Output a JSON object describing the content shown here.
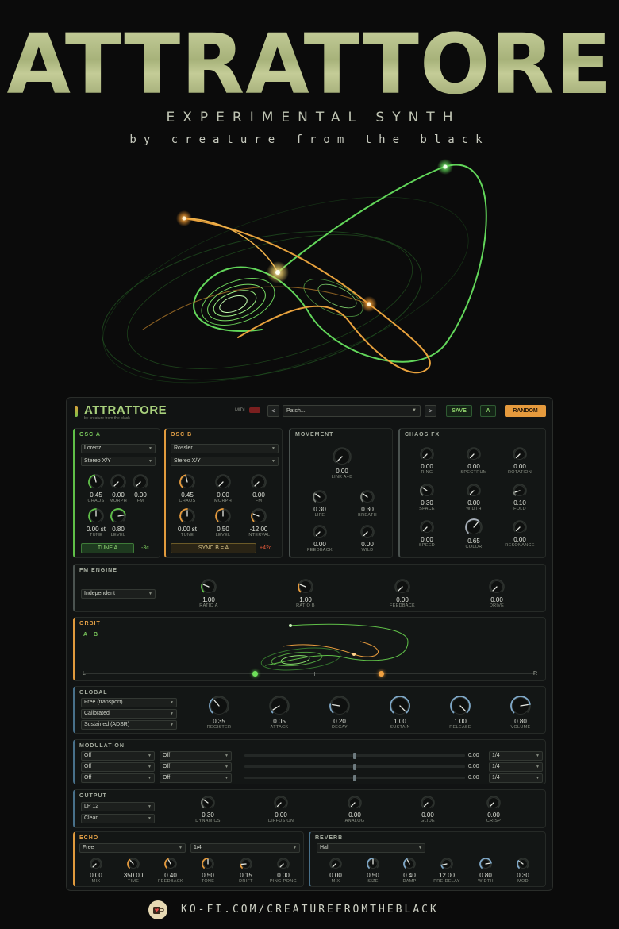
{
  "poster": {
    "title": "ATTRATTORE",
    "subtitle": "EXPERIMENTAL SYNTH",
    "byline": "by creature from the black"
  },
  "colors": {
    "green": "#5fbf48",
    "orange": "#e59a3d",
    "blue": "#48708a",
    "background": "#0b0b0b"
  },
  "header": {
    "logo": "ATTRATTORE",
    "logo_sub": "by creature from the black",
    "midi_label": "MIDI",
    "prev": "<",
    "next": ">",
    "patch": "Patch...",
    "save": "SAVE",
    "ab": "A",
    "random": "RANDOM"
  },
  "osc_a": {
    "title": "OSC A",
    "type": "Lorenz",
    "stereo": "Stereo X/Y",
    "knobs": [
      {
        "value": "0.45",
        "label": "CHAOS"
      },
      {
        "value": "0.00",
        "label": "MORPH"
      },
      {
        "value": "0.00",
        "label": "FM"
      },
      {
        "value": "0.00 st",
        "label": "TUNE"
      },
      {
        "value": "0.80",
        "label": "LEVEL"
      }
    ],
    "button": "TUNE A",
    "cents": "-3c"
  },
  "osc_b": {
    "title": "OSC B",
    "type": "Rossler",
    "stereo": "Stereo X/Y",
    "knobs": [
      {
        "value": "0.45",
        "label": "CHAOS"
      },
      {
        "value": "0.00",
        "label": "MORPH"
      },
      {
        "value": "0.00",
        "label": "FM"
      },
      {
        "value": "0.00 st",
        "label": "TUNE"
      },
      {
        "value": "0.50",
        "label": "LEVEL"
      },
      {
        "value": "-12.00",
        "label": "INTERVAL"
      }
    ],
    "button": "SYNC B = A",
    "cents": "+42c"
  },
  "movement": {
    "title": "MOVEMENT",
    "knobs": [
      {
        "value": "0.00",
        "label": "LINK A+B"
      },
      {
        "value": "0.30",
        "label": "LIFE"
      },
      {
        "value": "0.30",
        "label": "BREATH"
      },
      {
        "value": "0.00",
        "label": "FEEDBACK"
      },
      {
        "value": "0.00",
        "label": "WILD"
      }
    ]
  },
  "chaos_fx": {
    "title": "CHAOS FX",
    "knobs": [
      {
        "value": "0.00",
        "label": "RING"
      },
      {
        "value": "0.00",
        "label": "SPECTRUM"
      },
      {
        "value": "0.00",
        "label": "ROTATION"
      },
      {
        "value": "0.30",
        "label": "SPACE"
      },
      {
        "value": "0.00",
        "label": "WIDTH"
      },
      {
        "value": "0.10",
        "label": "FOLD"
      },
      {
        "value": "0.00",
        "label": "SPEED"
      },
      {
        "value": "0.65",
        "label": "COLOR"
      },
      {
        "value": "0.00",
        "label": "RESONANCE"
      }
    ]
  },
  "fm_engine": {
    "title": "FM ENGINE",
    "mode": "Independent",
    "knobs": [
      {
        "value": "1.00",
        "label": "RATIO A"
      },
      {
        "value": "1.00",
        "label": "RATIO B"
      },
      {
        "value": "0.00",
        "label": "FEEDBACK"
      },
      {
        "value": "0.00",
        "label": "DRIVE"
      }
    ]
  },
  "orbit": {
    "title": "ORBIT",
    "a": "A",
    "b": "B",
    "left": "L",
    "right": "R",
    "pan_a": 0.38,
    "pan_b": 0.66
  },
  "global": {
    "title": "GLOBAL",
    "selects": [
      "Free (transport)",
      "Calibrated",
      "Sustained (ADSR)"
    ],
    "knobs": [
      {
        "value": "0.35",
        "label": "REGISTER"
      },
      {
        "value": "0.05",
        "label": "ATTACK"
      },
      {
        "value": "0.20",
        "label": "DECAY"
      },
      {
        "value": "1.00",
        "label": "SUSTAIN"
      },
      {
        "value": "1.00",
        "label": "RELEASE"
      },
      {
        "value": "0.80",
        "label": "VOLUME"
      }
    ]
  },
  "modulation": {
    "title": "MODULATION",
    "rows": [
      {
        "source": "Off",
        "target": "Off",
        "amount": "0.00",
        "rate": "1/4"
      },
      {
        "source": "Off",
        "target": "Off",
        "amount": "0.00",
        "rate": "1/4"
      },
      {
        "source": "Off",
        "target": "Off",
        "amount": "0.00",
        "rate": "1/4"
      }
    ]
  },
  "output": {
    "title": "OUTPUT",
    "filter": "LP 12",
    "mode": "Clean",
    "knobs": [
      {
        "value": "0.30",
        "label": "DYNAMICS"
      },
      {
        "value": "0.00",
        "label": "DIFFUSION"
      },
      {
        "value": "0.00",
        "label": "ANALOG"
      },
      {
        "value": "0.00",
        "label": "GLIDE"
      },
      {
        "value": "0.00",
        "label": "CRISP"
      }
    ]
  },
  "echo": {
    "title": "ECHO",
    "sync": "Free",
    "division": "1/4",
    "knobs": [
      {
        "value": "0.00",
        "label": "MIX"
      },
      {
        "value": "350.00",
        "label": "TIME"
      },
      {
        "value": "0.40",
        "label": "FEEDBACK"
      },
      {
        "value": "0.50",
        "label": "TONE"
      },
      {
        "value": "0.15",
        "label": "DRIFT"
      },
      {
        "value": "0.00",
        "label": "PING-PONG"
      }
    ]
  },
  "reverb": {
    "title": "REVERB",
    "type": "Hall",
    "knobs": [
      {
        "value": "0.00",
        "label": "MIX"
      },
      {
        "value": "0.50",
        "label": "SIZE"
      },
      {
        "value": "0.40",
        "label": "DAMP"
      },
      {
        "value": "12.00",
        "label": "PRE-DELAY"
      },
      {
        "value": "0.80",
        "label": "WIDTH"
      },
      {
        "value": "0.30",
        "label": "MOD"
      }
    ]
  },
  "footer": {
    "link": "KO-FI.COM/CREATUREFROMTHEBLACK"
  }
}
